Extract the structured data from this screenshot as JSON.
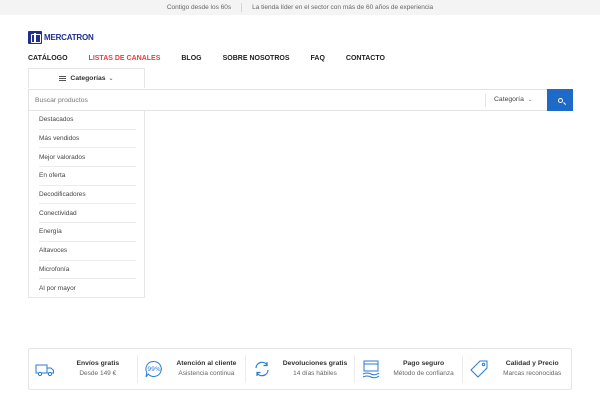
{
  "topbar": {
    "left_text": "Contigo desde los 60s",
    "right_text": "La tienda líder en el sector con más de 60 años de experiencia"
  },
  "logo": {
    "name": "MERCATRON"
  },
  "nav": [
    {
      "label": "CATÁLOGO"
    },
    {
      "label": "LISTAS DE CANALES"
    },
    {
      "label": "BLOG"
    },
    {
      "label": "SOBRE NOSOTROS"
    },
    {
      "label": "FAQ"
    },
    {
      "label": "CONTACTO"
    }
  ],
  "colors": {
    "accent": "#e4413a",
    "brand": "#1d2f8f",
    "search_button": "#1e6ac8"
  },
  "categories_button": {
    "label": "Categorías",
    "icon": "menu-icon"
  },
  "search": {
    "placeholder": "Buscar productos",
    "category_select": "Categoría",
    "button_icon": "search-icon"
  },
  "dropdown": {
    "items": [
      "Destacados",
      "Más vendidos",
      "Mejor valorados",
      "En oferta",
      "Decodificadores",
      "Conectividad",
      "Energía",
      "Altavoces",
      "Microfonía",
      "Al por mayor"
    ]
  },
  "features": [
    {
      "title": "Envíos gratis",
      "subtitle": "Desde 149 €",
      "icon": "truck-icon"
    },
    {
      "title": "Atención al cliente",
      "subtitle": "Asistencia continua",
      "icon": "support-99-icon"
    },
    {
      "title": "Devoluciones gratis",
      "subtitle": "14 días hábiles",
      "icon": "refresh-icon"
    },
    {
      "title": "Pago seguro",
      "subtitle": "Método de confianza",
      "icon": "secure-payment-icon"
    },
    {
      "title": "Calidad y Precio",
      "subtitle": "Marcas reconocidas",
      "icon": "price-tag-icon"
    }
  ]
}
